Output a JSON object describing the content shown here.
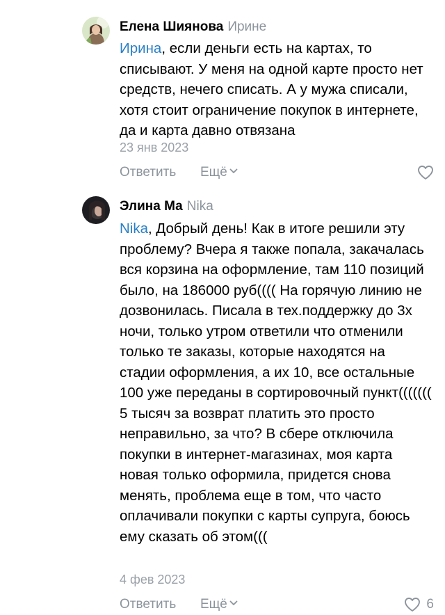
{
  "comments": [
    {
      "author": "Елена Шиянова",
      "reply_to": "Ирине",
      "mention": "Ирина",
      "text": ", если деньги есть на картах, то списывают. У меня на одной карте просто нет средств, нечего списать. А у мужа списали, хотя стоит ограничение покупок в интернете, да и карта давно отвязана",
      "date": "23 янв 2023",
      "reply_label": "Ответить",
      "more_label": "Ещё",
      "likes": ""
    },
    {
      "author": "Элина Ма",
      "reply_to": "Nika",
      "mention": "Nika",
      "text": ", Добрый день! Как в итоге решили эту проблему? Вчера я также попала, закачалась вся корзина на оформление, там 110 позиций было, на 186000 руб(((( На горячую линию не дозвонилась. Писала в тех.поддержку до 3х ночи, только утром ответили что отменили только те заказы, которые находятся на стадии оформления, а их 10, все остальные 100 уже переданы в сортировочный пункт((((((( 5 тысяч за возврат платить это просто неправильно, за что? В сбере отключила покупки в интернет-магазинах, моя карта новая только оформила, придется снова менять, проблема еще в том, что часто оплачивали покупки с карты супруга, боюсь ему сказать об этом(((",
      "date": "4 фев 2023",
      "reply_label": "Ответить",
      "more_label": "Ещё",
      "likes": "6"
    }
  ],
  "colors": {
    "mention": "#2a80c6",
    "secondary": "#8c949c",
    "date": "#9aa1a8"
  },
  "icons": {
    "like": "heart-outline-icon",
    "more": "chevron-down-icon"
  }
}
